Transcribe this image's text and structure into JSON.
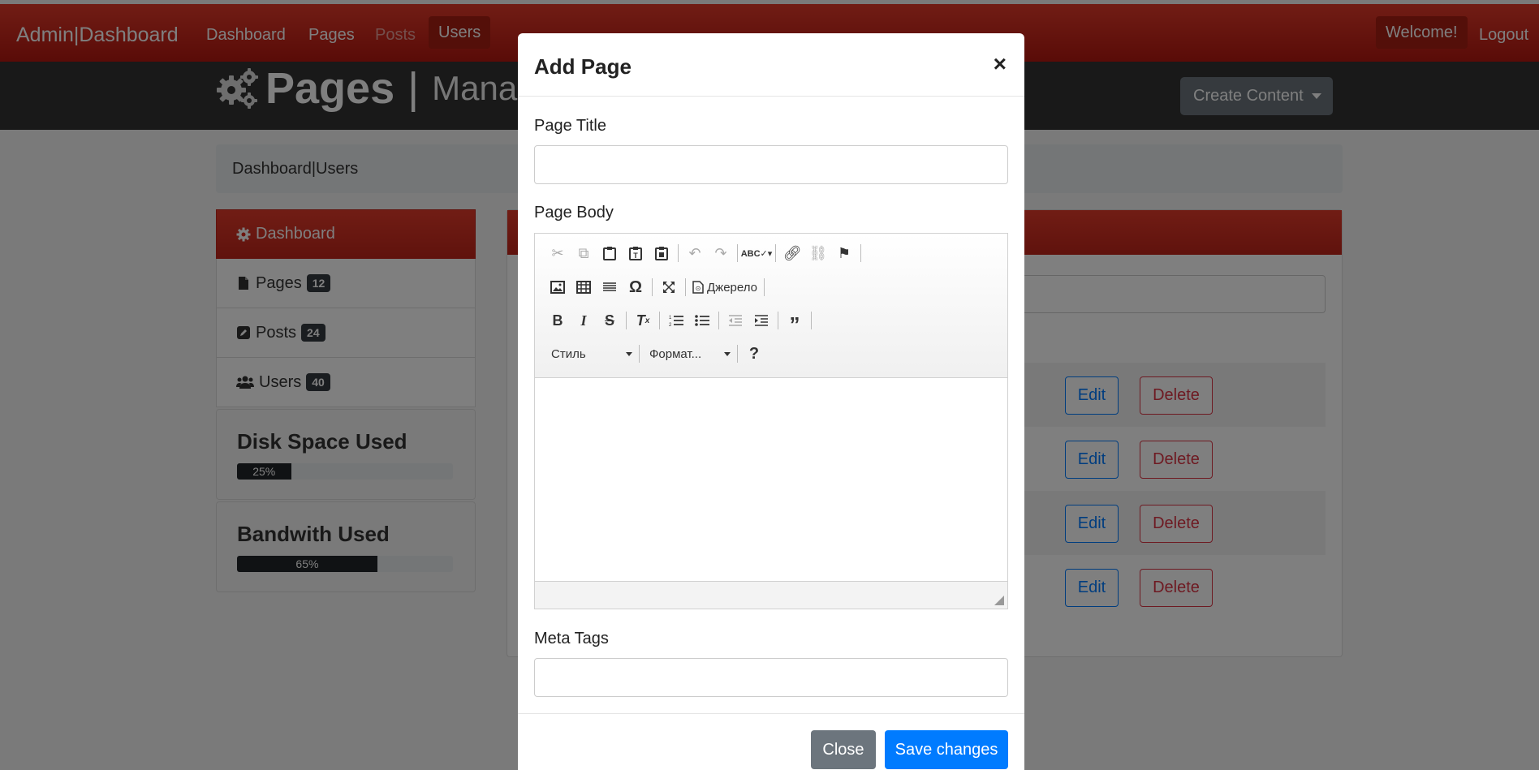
{
  "navbar": {
    "brand": "Admin|Dashboard",
    "links": [
      "Dashboard",
      "Pages",
      "Posts",
      "Users"
    ],
    "welcome": "Welcome!",
    "logout": "Logout"
  },
  "header": {
    "title": "Pages",
    "separator": "|",
    "subtitle": "Manage",
    "create_button": "Create Content"
  },
  "breadcrumb": "Dashboard|Users",
  "sidebar": {
    "items": [
      {
        "label": "Dashboard",
        "icon": "gear-icon"
      },
      {
        "label": "Pages",
        "badge": "12",
        "icon": "file-icon"
      },
      {
        "label": "Posts",
        "badge": "24",
        "icon": "pencil-icon"
      },
      {
        "label": "Users",
        "badge": "40",
        "icon": "users-icon"
      }
    ],
    "disk": {
      "title": "Disk Space Used",
      "value": 0.25,
      "label": "25%"
    },
    "bandwidth": {
      "title": "Bandwith Used",
      "value": 0.65,
      "label": "65%"
    }
  },
  "table": {
    "edit_label": "Edit",
    "delete_label": "Delete"
  },
  "modal": {
    "title": "Add Page",
    "close_symbol": "×",
    "page_title_label": "Page Title",
    "page_body_label": "Page Body",
    "meta_tags_label": "Meta Tags",
    "source_button": "Джерело",
    "style_combo": "Стиль",
    "format_combo": "Формат...",
    "help": "?",
    "close_button": "Close",
    "save_button": "Save changes"
  },
  "colors": {
    "brand_red": "#d9281b",
    "primary": "#007bff",
    "danger": "#dc3545",
    "secondary": "#6c757d"
  }
}
